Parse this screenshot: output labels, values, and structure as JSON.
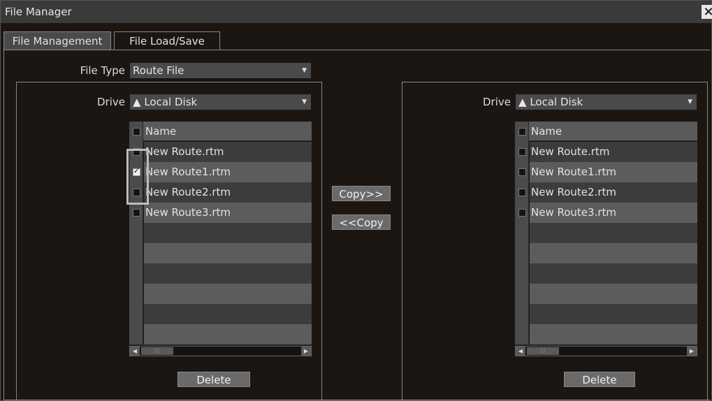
{
  "window": {
    "title": "File Manager",
    "close_glyph": "×"
  },
  "tabs": [
    {
      "label": "File Management",
      "active": true
    },
    {
      "label": "File Load/Save",
      "active": false
    }
  ],
  "file_type": {
    "label": "File Type",
    "value": "Route File"
  },
  "left": {
    "drive_label": "Drive",
    "drive_value": "Local Disk",
    "drive_icon": "disk-icon",
    "header": "Name",
    "files": [
      {
        "name": "New Route.rtm",
        "checked": false
      },
      {
        "name": "New Route1.rtm",
        "checked": true
      },
      {
        "name": "New Route2.rtm",
        "checked": false
      },
      {
        "name": "New Route3.rtm",
        "checked": false
      }
    ],
    "delete_label": "Delete"
  },
  "right": {
    "drive_label": "Drive",
    "drive_value": "Local Disk",
    "drive_icon": "disk-icon",
    "header": "Name",
    "files": [
      {
        "name": "New Route.rtm",
        "checked": false
      },
      {
        "name": "New Route1.rtm",
        "checked": false
      },
      {
        "name": "New Route2.rtm",
        "checked": false
      },
      {
        "name": "New Route3.rtm",
        "checked": false
      }
    ],
    "delete_label": "Delete"
  },
  "copy_right_label": "Copy>>",
  "copy_left_label": "<<Copy"
}
